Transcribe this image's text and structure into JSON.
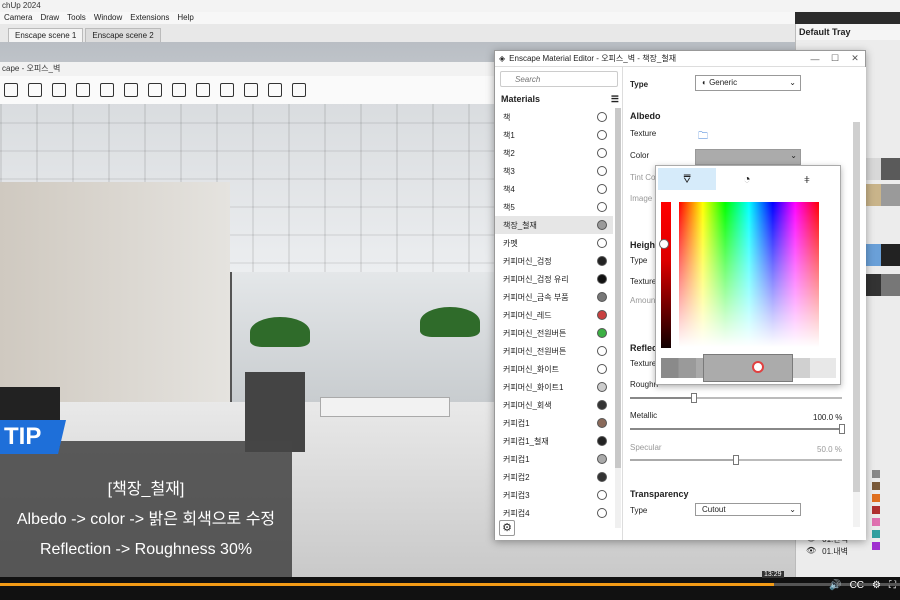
{
  "app": {
    "title": "chUp 2024",
    "menu": [
      "Camera",
      "Draw",
      "Tools",
      "Window",
      "Extensions",
      "Help"
    ]
  },
  "scene_tabs": [
    "Enscape scene 1",
    "Enscape scene 2"
  ],
  "viewer": {
    "title": "cape - 오피스_벽"
  },
  "tray": {
    "title": "Default Tray",
    "layers": [
      "01.판넥",
      "01.내벽"
    ]
  },
  "tip": {
    "badge": "TIP",
    "line1": "[책장_철재]",
    "line2": "Albedo -> color -> 밝은 회색으로 수정",
    "line3": "Reflection -> Roughness 30%"
  },
  "video": {
    "timestamp": "13:29",
    "progress": 0.86
  },
  "editor": {
    "title": "Enscape Material Editor - 오피스_벽 - 책장_철재",
    "search_placeholder": "Search",
    "materials_header": "Materials",
    "materials": [
      {
        "name": "책",
        "color": "#ffffff"
      },
      {
        "name": "책1",
        "color": "#ffffff"
      },
      {
        "name": "책2",
        "color": "#ffffff"
      },
      {
        "name": "책3",
        "color": "#ffffff"
      },
      {
        "name": "책4",
        "color": "#ffffff"
      },
      {
        "name": "책5",
        "color": "#ffffff"
      },
      {
        "name": "책장_철재",
        "color": "#9a9a9a",
        "selected": true
      },
      {
        "name": "카펫",
        "color": "#ffffff"
      },
      {
        "name": "커피머신_검정",
        "color": "#222222"
      },
      {
        "name": "커피머신_검정 유리",
        "color": "#111111"
      },
      {
        "name": "커피머신_금속 부품",
        "color": "#777777"
      },
      {
        "name": "커피머신_레드",
        "color": "#c84040"
      },
      {
        "name": "커피머신_전원버튼",
        "color": "#3cb043"
      },
      {
        "name": "커피머신_전원버튼",
        "color": "#ffffff"
      },
      {
        "name": "커피머신_화이트",
        "color": "#ffffff"
      },
      {
        "name": "커피머신_화이트1",
        "color": "#cccccc"
      },
      {
        "name": "커피머신_회색",
        "color": "#333333"
      },
      {
        "name": "커피컵1",
        "color": "#8a6a5a"
      },
      {
        "name": "커피컵1_철재",
        "color": "#222222"
      },
      {
        "name": "커피컵1",
        "color": "#aaaaaa"
      },
      {
        "name": "커피컵2",
        "color": "#333333"
      },
      {
        "name": "커피컵3",
        "color": "#ffffff"
      },
      {
        "name": "커피컵4",
        "color": "#ffffff"
      }
    ],
    "type_label": "Type",
    "type_value": "Generic",
    "albedo": {
      "header": "Albedo",
      "texture_label": "Texture",
      "color_label": "Color",
      "tint_label": "Tint Co",
      "image_label": "Image F",
      "color_value": "#ababab"
    },
    "height": {
      "header": "Height",
      "type_label": "Type",
      "texture_label": "Texture",
      "amount_label": "Amoun"
    },
    "reflection": {
      "header": "Reflec",
      "texture_label": "Texture",
      "roughness_label": "Roughn",
      "roughness": 0.3,
      "metallic_label": "Metallic",
      "metallic_value": "100.0 %",
      "metallic": 1.0,
      "specular_label": "Specular",
      "specular_value": "50.0 %",
      "specular": 0.5
    },
    "transparency": {
      "header": "Transparency",
      "type_label": "Type",
      "type_value": "Cutout"
    }
  },
  "colors": {
    "accent": "#1e6fd9",
    "progress": "#f39b16",
    "picker_tab_active": "#d6ebfa"
  }
}
